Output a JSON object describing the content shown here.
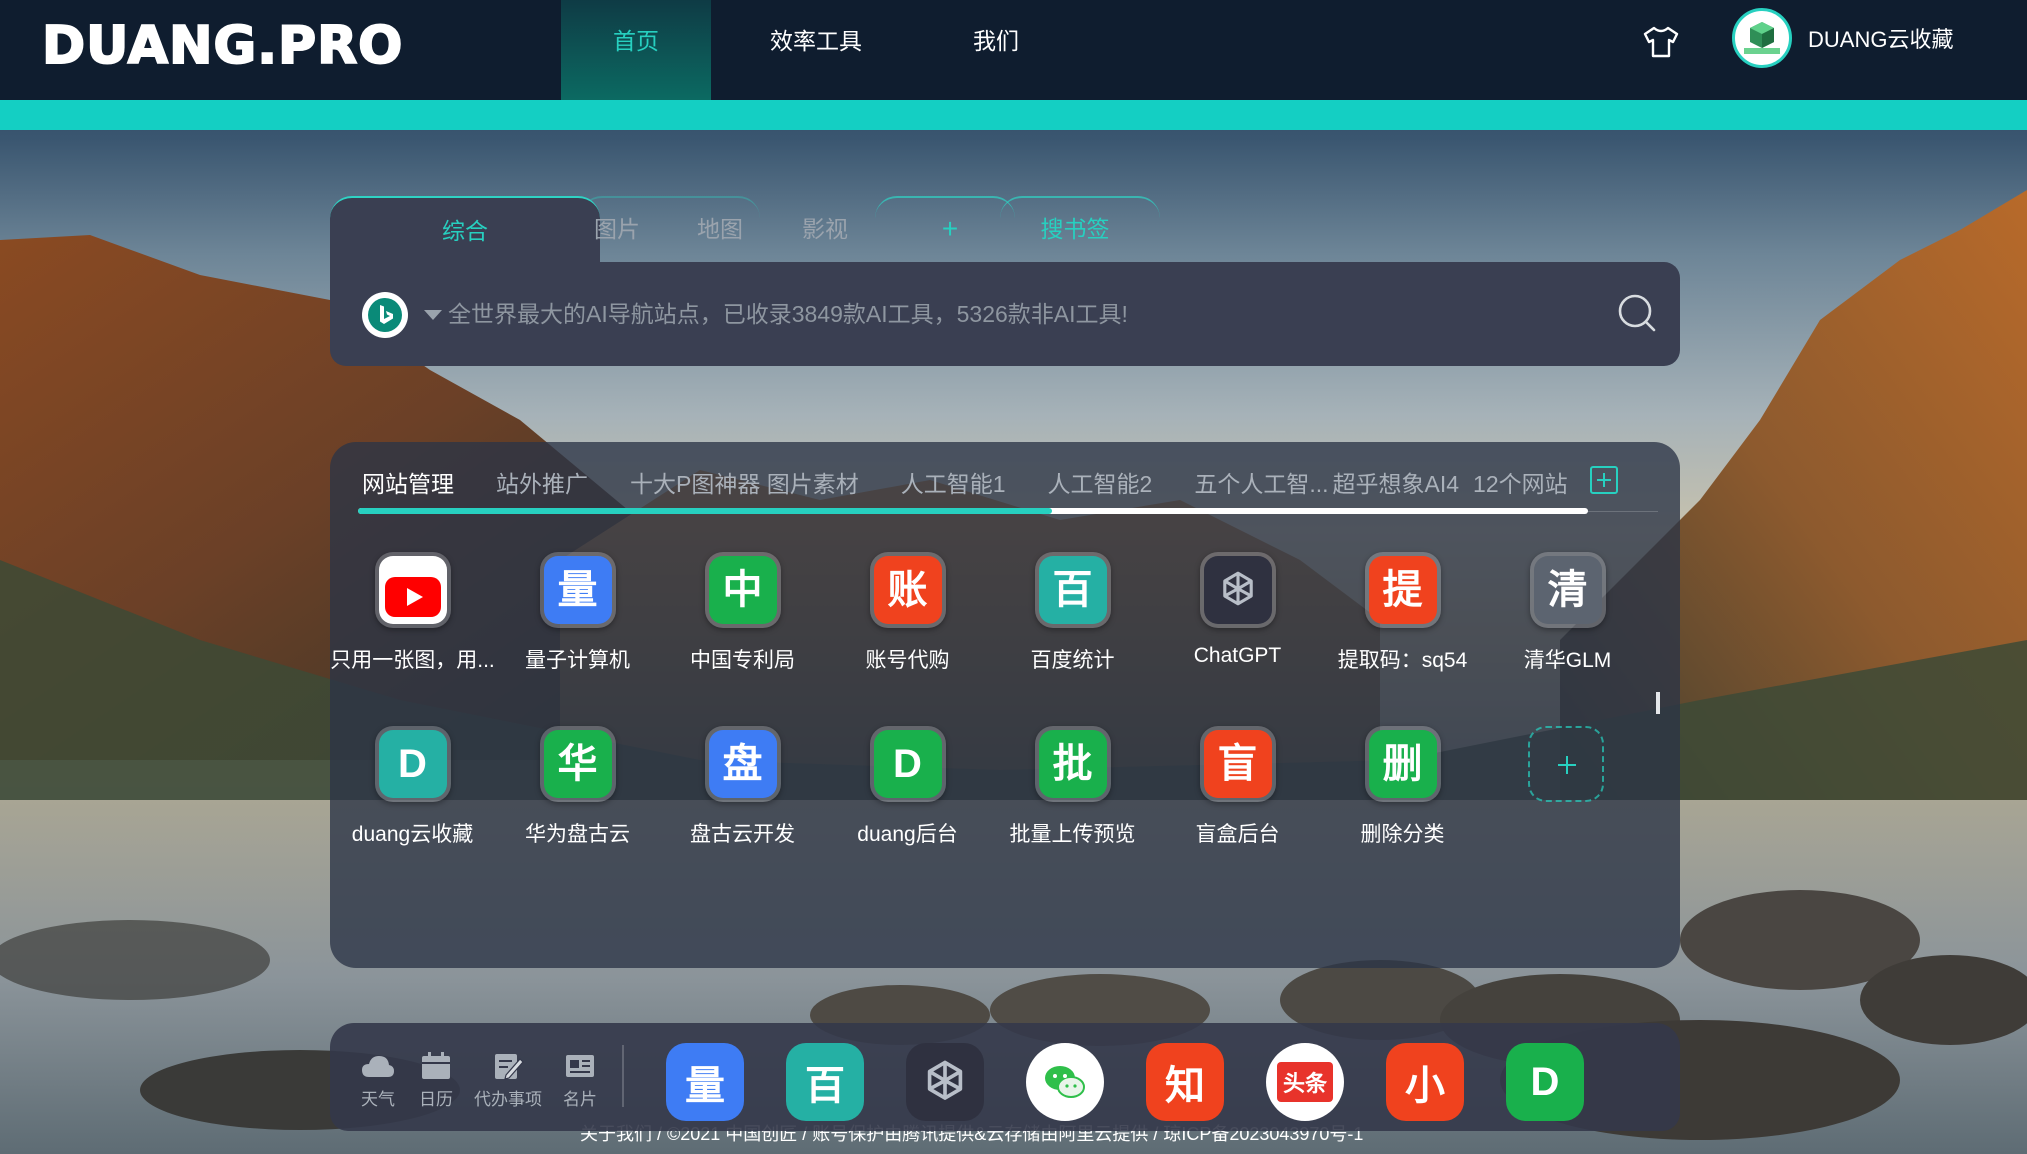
{
  "header": {
    "logo": "DUANG.PRO",
    "nav": [
      {
        "label": "首页",
        "active": true
      },
      {
        "label": "效率工具",
        "active": false
      },
      {
        "label": "我们",
        "active": false
      }
    ],
    "skin_icon": "tshirt-icon",
    "user_name": "DUANG云收藏"
  },
  "search": {
    "tabs": [
      "综合",
      "图片",
      "地图",
      "影视",
      "+",
      "搜书签"
    ],
    "active_tab": "综合",
    "engine_icon": "bing-icon",
    "placeholder": "全世界最大的AI导航站点，已收录3849款AI工具，5326款非AI工具!"
  },
  "bookmarks": {
    "tabs": [
      "网站管理",
      "站外推广",
      "十大P图神器 图片素材",
      "人工智能1",
      "人工智能2",
      "五个人工智...",
      "超乎想象AI4",
      "12个网站"
    ],
    "active_tab": "网站管理",
    "sites": [
      {
        "name": "只用一张图，用...",
        "glyph": "▶",
        "bg": "#ff0000",
        "icon": "youtube-icon"
      },
      {
        "name": "量子计算机",
        "glyph": "量",
        "bg": "#3e7cf4",
        "icon": "text-icon"
      },
      {
        "name": "中国专利局",
        "glyph": "中",
        "bg": "#19b04c",
        "icon": "text-icon"
      },
      {
        "name": "账号代购",
        "glyph": "账",
        "bg": "#f0421e",
        "icon": "text-icon"
      },
      {
        "name": "百度统计",
        "glyph": "百",
        "bg": "#25b0a4",
        "icon": "text-icon"
      },
      {
        "name": "ChatGPT",
        "glyph": "",
        "bg": "#2f3140",
        "icon": "openai-icon"
      },
      {
        "name": "提取码：sq54",
        "glyph": "提",
        "bg": "#f0421e",
        "icon": "text-icon"
      },
      {
        "name": "清华GLM",
        "glyph": "清",
        "bg": "#5c6470",
        "icon": "text-icon"
      },
      {
        "name": "duang云收藏",
        "glyph": "D",
        "bg": "#25b0a4",
        "icon": "text-icon"
      },
      {
        "name": "华为盘古云",
        "glyph": "华",
        "bg": "#19b04c",
        "icon": "text-icon"
      },
      {
        "name": "盘古云开发",
        "glyph": "盘",
        "bg": "#3e7cf4",
        "icon": "text-icon"
      },
      {
        "name": "duang后台",
        "glyph": "D",
        "bg": "#19b04c",
        "icon": "text-icon"
      },
      {
        "name": "批量上传预览",
        "glyph": "批",
        "bg": "#19b04c",
        "icon": "text-icon"
      },
      {
        "name": "盲盒后台",
        "glyph": "盲",
        "bg": "#f0421e",
        "icon": "text-icon"
      },
      {
        "name": "删除分类",
        "glyph": "删",
        "bg": "#19b04c",
        "icon": "text-icon"
      }
    ],
    "add_icon": "plus-icon"
  },
  "dock": {
    "tools": [
      {
        "label": "天气",
        "icon": "cloud-icon"
      },
      {
        "label": "日历",
        "icon": "calendar-icon"
      },
      {
        "label": "代办事项",
        "icon": "todo-icon"
      },
      {
        "label": "名片",
        "icon": "card-icon"
      }
    ],
    "apps": [
      {
        "glyph": "量",
        "bg": "#3e7cf4",
        "icon": "text-icon"
      },
      {
        "glyph": "百",
        "bg": "#25b0a4",
        "icon": "text-icon"
      },
      {
        "glyph": "",
        "bg": "#2f3140",
        "icon": "openai-icon"
      },
      {
        "glyph": "",
        "bg": "#ffffff",
        "icon": "wechat-icon"
      },
      {
        "glyph": "知",
        "bg": "#f0421e",
        "icon": "text-icon"
      },
      {
        "glyph": "头条",
        "bg": "#ffffff",
        "icon": "toutiao-icon"
      },
      {
        "glyph": "小",
        "bg": "#f0421e",
        "icon": "text-icon"
      },
      {
        "glyph": "D",
        "bg": "#19b04c",
        "icon": "text-icon"
      }
    ]
  },
  "footer": {
    "text": "关于我们  /  ©2021 中国创匠  /  账号保护由腾讯提供&云存储由阿里云提供  /  琼ICP备2023043970号-1"
  }
}
